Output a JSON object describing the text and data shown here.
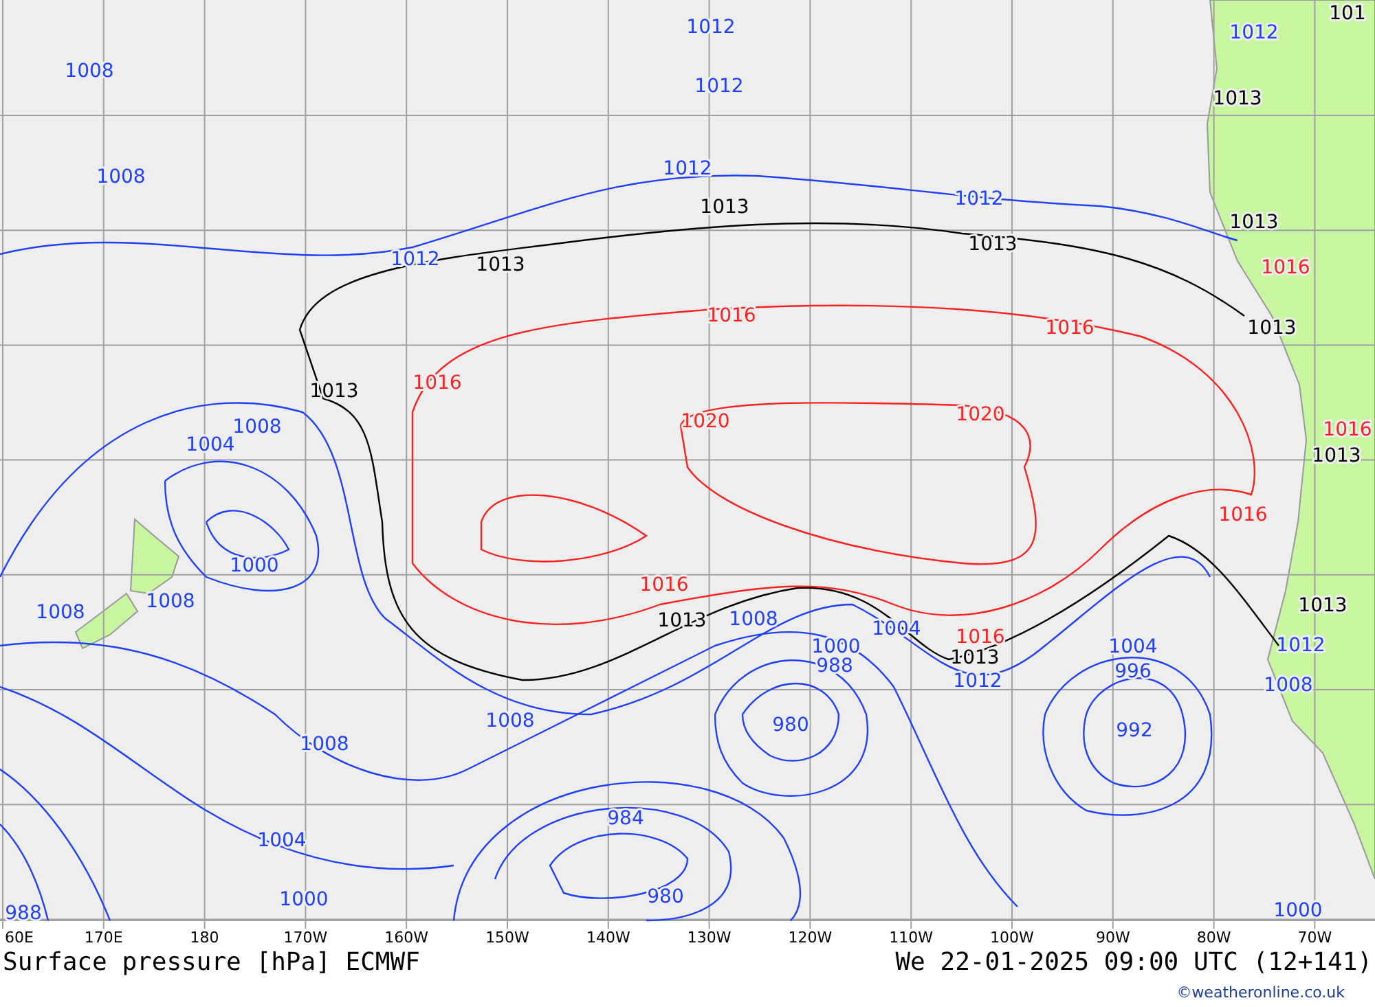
{
  "map": {
    "isobar_labels": [
      {
        "text": "1012",
        "kind": "below"
      },
      {
        "text": "1008",
        "kind": "below"
      },
      {
        "text": "1012",
        "kind": "below"
      },
      {
        "text": "1008",
        "kind": "below"
      },
      {
        "text": "1012",
        "kind": "below"
      },
      {
        "text": "1012",
        "kind": "below"
      },
      {
        "text": "1012",
        "kind": "below"
      },
      {
        "text": "1013",
        "kind": "reference"
      },
      {
        "text": "1013",
        "kind": "reference"
      },
      {
        "text": "1013",
        "kind": "reference"
      },
      {
        "text": "1013",
        "kind": "reference"
      },
      {
        "text": "1016",
        "kind": "above"
      },
      {
        "text": "1016",
        "kind": "above"
      },
      {
        "text": "1016",
        "kind": "above"
      },
      {
        "text": "1020",
        "kind": "above"
      },
      {
        "text": "1020",
        "kind": "above"
      },
      {
        "text": "1013",
        "kind": "reference"
      },
      {
        "text": "1008",
        "kind": "below"
      },
      {
        "text": "1004",
        "kind": "below"
      },
      {
        "text": "1000",
        "kind": "below"
      },
      {
        "text": "1008",
        "kind": "below"
      },
      {
        "text": "1008",
        "kind": "below"
      },
      {
        "text": "1016",
        "kind": "above"
      },
      {
        "text": "1013",
        "kind": "reference"
      },
      {
        "text": "1008",
        "kind": "below"
      },
      {
        "text": "1004",
        "kind": "below"
      },
      {
        "text": "1000",
        "kind": "below"
      },
      {
        "text": "988",
        "kind": "below"
      },
      {
        "text": "1016",
        "kind": "above"
      },
      {
        "text": "1013",
        "kind": "reference"
      },
      {
        "text": "1012",
        "kind": "below"
      },
      {
        "text": "1004",
        "kind": "below"
      },
      {
        "text": "996",
        "kind": "below"
      },
      {
        "text": "1008",
        "kind": "below"
      },
      {
        "text": "1008",
        "kind": "below"
      },
      {
        "text": "980",
        "kind": "below"
      },
      {
        "text": "992",
        "kind": "below"
      },
      {
        "text": "1004",
        "kind": "below"
      },
      {
        "text": "984",
        "kind": "below"
      },
      {
        "text": "1000",
        "kind": "below"
      },
      {
        "text": "980",
        "kind": "below"
      },
      {
        "text": "988",
        "kind": "below"
      },
      {
        "text": "1000",
        "kind": "below"
      },
      {
        "text": "101",
        "kind": "reference"
      },
      {
        "text": "1012",
        "kind": "below"
      },
      {
        "text": "1013",
        "kind": "reference"
      },
      {
        "text": "1013",
        "kind": "reference"
      },
      {
        "text": "1016",
        "kind": "above"
      },
      {
        "text": "1016",
        "kind": "above"
      },
      {
        "text": "1016",
        "kind": "above"
      },
      {
        "text": "1013",
        "kind": "reference"
      },
      {
        "text": "1013",
        "kind": "reference"
      },
      {
        "text": "1012",
        "kind": "below"
      },
      {
        "text": "1008",
        "kind": "below"
      }
    ],
    "longitude_labels": [
      "60E",
      "170E",
      "180",
      "170W",
      "160W",
      "150W",
      "140W",
      "130W",
      "120W",
      "110W",
      "100W",
      "90W",
      "80W",
      "70W"
    ]
  },
  "title": "Surface pressure [hPa] ECMWF",
  "valid_time": "We 22-01-2025 09:00 UTC (12+141)",
  "credit": "©weatheronline.co.uk"
}
